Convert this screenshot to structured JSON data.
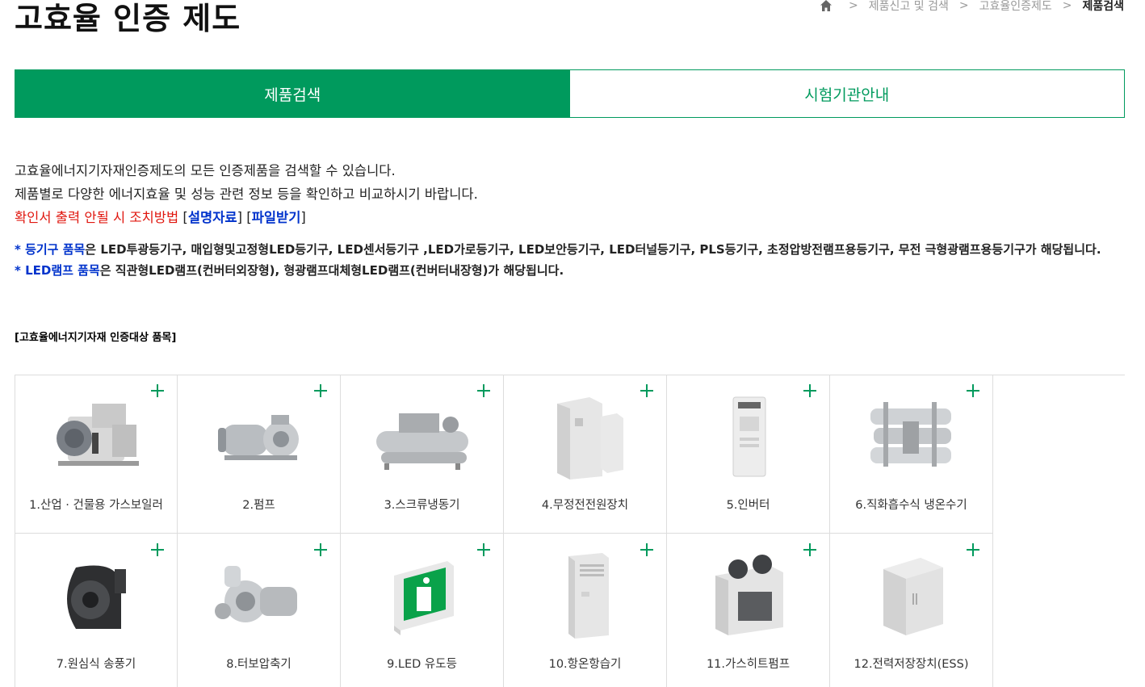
{
  "page": {
    "title": "고효율 인증 제도"
  },
  "breadcrumb": {
    "items": [
      "제품신고 및 검색",
      "고효율인증제도",
      "제품검색"
    ]
  },
  "tabs": [
    {
      "label": "제품검색",
      "active": true
    },
    {
      "label": "시험기관안내",
      "active": false
    }
  ],
  "intro": {
    "line1": "고효율에너지기자재인증제도의 모든 인증제품을 검색할 수 있습니다.",
    "line2": "제품별로 다양한 에너지효율 및 성능 관련 정보 등을 확인하고 비교하시기 바랍니다.",
    "line3": "확인서 출력 안될 시 조치방법",
    "link_guide": "설명자료",
    "link_download": "파일받기"
  },
  "notes": {
    "lighting_key": "* 등기구 품목",
    "lighting_text": "은 LED투광등기구, 매입형및고정형LED등기구, LED센서등기구 ,LED가로등기구, LED보안등기구, LED터널등기구, PLS등기구, 초정압방전램프용등기구, 무전 극형광램프용등기구가 해당됩니다.",
    "lamp_key": "* LED램프 품목",
    "lamp_text": "은 직관형LED램프(컨버터외장형), 형광램프대체형LED램프(컨버터내장형)가 해당됩니다."
  },
  "section": {
    "title": "[고효율에너지기자재 인증대상 품목]"
  },
  "products": [
    {
      "label": "1.산업 · 건물용 가스보일러",
      "icon": "gas-boiler-icon"
    },
    {
      "label": "2.펌프",
      "icon": "pump-icon"
    },
    {
      "label": "3.스크류냉동기",
      "icon": "screw-chiller-icon"
    },
    {
      "label": "4.무정전전원장치",
      "icon": "ups-icon"
    },
    {
      "label": "5.인버터",
      "icon": "inverter-icon"
    },
    {
      "label": "6.직화흡수식 냉온수기",
      "icon": "absorption-chiller-icon"
    },
    {
      "label": "7.원심식 송풍기",
      "icon": "centrifugal-fan-icon"
    },
    {
      "label": "8.터보압축기",
      "icon": "turbo-compressor-icon"
    },
    {
      "label": "9.LED 유도등",
      "icon": "led-exit-sign-icon"
    },
    {
      "label": "10.항온항습기",
      "icon": "thermo-hygrostat-icon"
    },
    {
      "label": "11.가스히트펌프",
      "icon": "gas-heat-pump-icon"
    },
    {
      "label": "12.전력저장장치(ESS)",
      "icon": "ess-icon"
    }
  ],
  "colors": {
    "accent": "#009a5d",
    "red": "#e0170f",
    "blue": "#0033cc",
    "border": "#dddddd"
  }
}
